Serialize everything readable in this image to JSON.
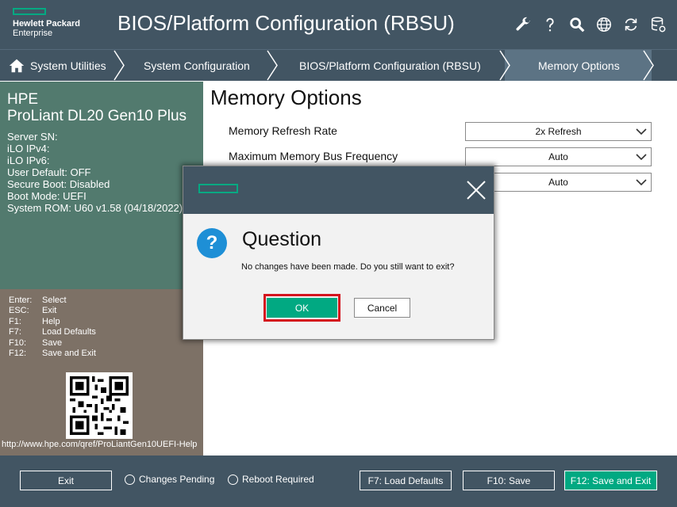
{
  "header": {
    "logo_line1": "Hewlett Packard",
    "logo_line2": "Enterprise",
    "title": "BIOS/Platform Configuration (RBSU)",
    "icons": [
      "wrench-icon",
      "help-icon",
      "search-icon",
      "globe-icon",
      "refresh-icon",
      "database-icon"
    ]
  },
  "breadcrumb": {
    "items": [
      {
        "label": "System Utilities",
        "icon": "home-icon"
      },
      {
        "label": "System Configuration"
      },
      {
        "label": "BIOS/Platform Configuration (RBSU)"
      },
      {
        "label": "Memory Options",
        "active": true
      }
    ]
  },
  "server_info": {
    "vendor": "HPE",
    "model": "ProLiant DL20 Gen10 Plus",
    "lines": [
      "Server SN:",
      "iLO IPv4:",
      "iLO IPv6:",
      "User Default: OFF",
      "Secure Boot: Disabled",
      "Boot Mode: UEFI",
      "System ROM: U60 v1.58 (04/18/2022)"
    ]
  },
  "keys": [
    {
      "key": "Enter:",
      "action": "Select"
    },
    {
      "key": "ESC:",
      "action": "Exit"
    },
    {
      "key": "F1:",
      "action": "Help"
    },
    {
      "key": "F7:",
      "action": "Load Defaults"
    },
    {
      "key": "F10:",
      "action": "Save"
    },
    {
      "key": "F12:",
      "action": "Save and Exit"
    }
  ],
  "help_url": "http://www.hpe.com/qref/ProLiantGen10UEFI-Help",
  "main": {
    "title": "Memory Options",
    "options": [
      {
        "label": "Memory Refresh Rate",
        "value": "2x Refresh"
      },
      {
        "label": "Maximum Memory Bus Frequency",
        "value": "Auto"
      },
      {
        "label": "",
        "value": "Auto"
      }
    ]
  },
  "dialog": {
    "title": "Question",
    "message": "No changes have been made. Do you still want to exit?",
    "ok_label": "OK",
    "cancel_label": "Cancel"
  },
  "footer": {
    "exit_label": "Exit",
    "changes_pending": "Changes Pending",
    "reboot_required": "Reboot Required",
    "f7_label": "F7: Load Defaults",
    "f10_label": "F10: Save",
    "f12_label": "F12: Save and Exit"
  },
  "colors": {
    "header_bg": "#425563",
    "accent_green": "#01a982",
    "info_panel": "#527a6e",
    "keys_panel": "#7d7166",
    "highlight_red": "#d4141e",
    "question_blue": "#1e8fd6"
  }
}
